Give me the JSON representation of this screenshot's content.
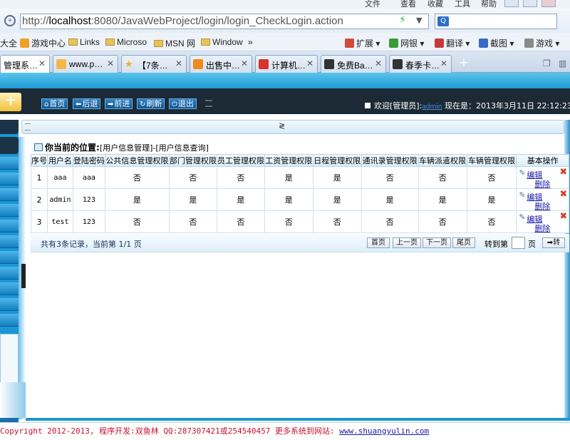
{
  "browser": {
    "menu": [
      "文件",
      "查看",
      "收藏",
      "工具",
      "帮助"
    ],
    "address_host": "localhost",
    "address_prefix": "http://",
    "address_rest": ":8080/JavaWebProject/login/login_CheckLogin.action",
    "favorites": [
      "大全",
      "游戏中心",
      "Links",
      "Microso",
      "MSN 网",
      "Window",
      "»"
    ],
    "toolbar_right": [
      "扩展",
      "网银",
      "翻译",
      "截图",
      "游戏"
    ],
    "tabs": [
      "管理系…",
      "www.p…",
      "【7条…",
      "出售中…",
      "计算机…",
      "免费Ba…",
      "春季卡…"
    ]
  },
  "app": {
    "logo_text": "十",
    "nav": [
      "首页",
      "后退",
      "前进",
      "刷新",
      "退出"
    ],
    "welcome_prefix": "欢迎[管理员]:",
    "welcome_user": "admin",
    "welcome_time": "现在是：2013年3月11日 22:12:23",
    "subbar_mark": "≷"
  },
  "location": {
    "label": "你当前的位置:",
    "path": "[用户信息管理]-[用户信息查询]"
  },
  "table": {
    "headers": [
      "序号",
      "用户名",
      "登陆密码",
      "公共信息管理权限",
      "部门管理权限",
      "员工管理权限",
      "工资管理权限",
      "日程管理权限",
      "通讯录管理权限",
      "车辆派遣权限",
      "车辆管理权限",
      "基本操作"
    ],
    "rows": [
      [
        "1",
        "aaa",
        "aaa",
        "否",
        "否",
        "否",
        "是",
        "是",
        "否",
        "否",
        "否"
      ],
      [
        "2",
        "admin",
        "123",
        "是",
        "是",
        "是",
        "是",
        "是",
        "是",
        "是",
        "是"
      ],
      [
        "3",
        "test",
        "123",
        "否",
        "否",
        "否",
        "否",
        "否",
        "否",
        "否",
        "否"
      ]
    ],
    "edit_label": "编辑",
    "delete_label": "删除"
  },
  "pager": {
    "info": "共有3条记录，当前第 1/1 页",
    "first": "首页",
    "prev": "上一页",
    "next": "下一页",
    "last": "尾页",
    "goto_label": "转到第",
    "page_unit": "页",
    "go": "➡转"
  },
  "footer": {
    "text": "Copyright 2012-2013, 程序开发:双鱼林  QQ:287307421或254540457  更多系统到网站: ",
    "link": "www.shuangyulin.com"
  },
  "colors": {
    "accent": "#1c96d4",
    "topbar": "#1c2a36",
    "footer_text": "#c8102e",
    "link": "#1a1aa6"
  }
}
